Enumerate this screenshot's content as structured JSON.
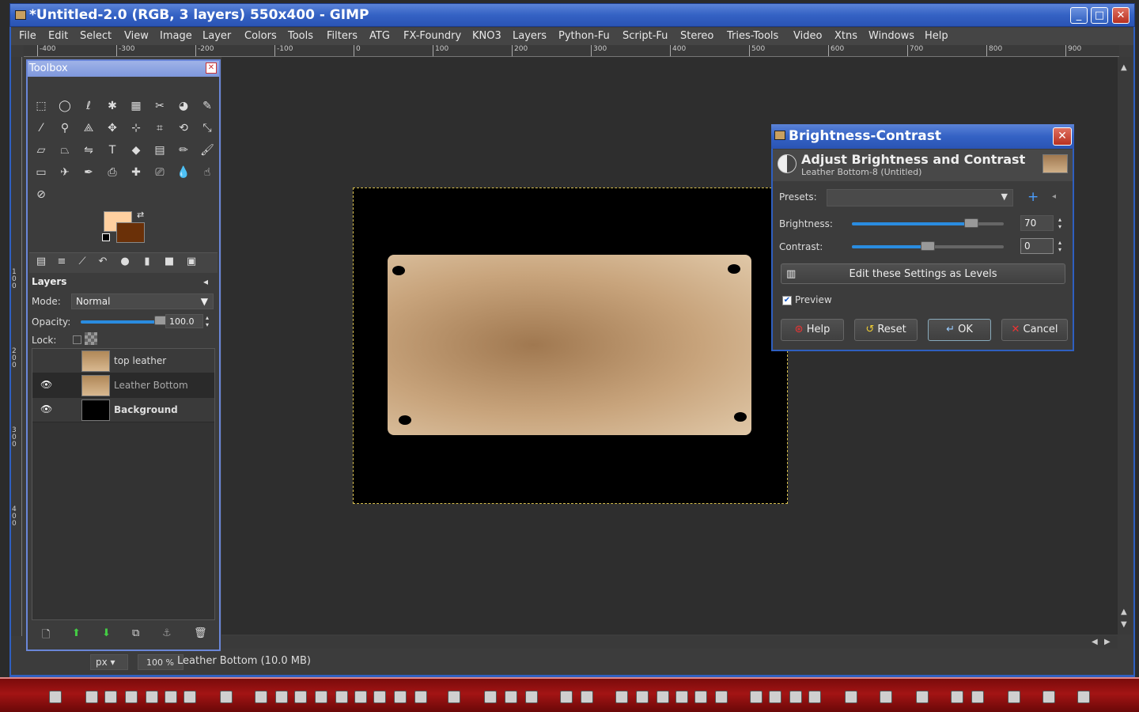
{
  "window": {
    "title": "*Untitled-2.0 (RGB, 3 layers) 550x400 - GIMP",
    "minimize": "_",
    "maximize": "□",
    "close": "✕"
  },
  "menu": [
    "File",
    "Edit",
    "Select",
    "View",
    "Image",
    "Layer",
    "Colors",
    "Tools",
    "Filters",
    "ATG",
    "FX-Foundry",
    "KNO3",
    "Layers",
    "Python-Fu",
    "Script-Fu",
    "Stereo",
    "Tries-Tools",
    "Video",
    "Xtns",
    "Windows",
    "Help"
  ],
  "ruler_h": [
    "-400",
    "-300",
    "-200",
    "-100",
    "0",
    "100",
    "200",
    "300",
    "400",
    "500",
    "600",
    "700",
    "800",
    "900"
  ],
  "ruler_v": [
    "1",
    "0",
    "0",
    "2",
    "0",
    "0",
    "3",
    "0",
    "0",
    "4",
    "0",
    "0"
  ],
  "toolbox": {
    "title": "Toolbox",
    "close": "✕",
    "fg_color": "#ffd0a0",
    "bg_color": "#6a3008",
    "layers_title": "Layers",
    "mode_label": "Mode:",
    "mode_value": "Normal",
    "opacity_label": "Opacity:",
    "opacity_value": "100.0",
    "opacity_fraction": 1.0,
    "lock_label": "Lock:",
    "layers": [
      {
        "name": "top leather",
        "visible": false,
        "bold": false
      },
      {
        "name": "Leather Bottom",
        "visible": true,
        "bold": false
      },
      {
        "name": "Background",
        "visible": true,
        "bold": true
      }
    ],
    "actions": [
      "new-layer-icon",
      "raise-layer-icon",
      "lower-layer-icon",
      "duplicate-layer-icon",
      "anchor-layer-icon",
      "delete-layer-icon"
    ]
  },
  "status": {
    "unit": "px",
    "zoom": "100 %",
    "text": "Leather Bottom (10.0 MB)"
  },
  "dialog": {
    "title": "Brightness-Contrast",
    "close": "✕",
    "heading": "Adjust Brightness and Contrast",
    "subheading": "Leather Bottom-8 (Untitled)",
    "presets_label": "Presets:",
    "brightness_label": "Brightness:",
    "brightness_value": "70",
    "brightness_fraction": 0.785,
    "contrast_label": "Contrast:",
    "contrast_value": "0",
    "contrast_fraction": 0.5,
    "levels_button": "Edit these Settings as Levels",
    "preview_label": "Preview",
    "preview_checked": true,
    "help": "Help",
    "reset": "Reset",
    "ok": "OK",
    "cancel": "Cancel"
  },
  "colors": {
    "titlebar": "#3462c4",
    "slider": "#2a8ce0",
    "taskbar": "#a31414"
  }
}
